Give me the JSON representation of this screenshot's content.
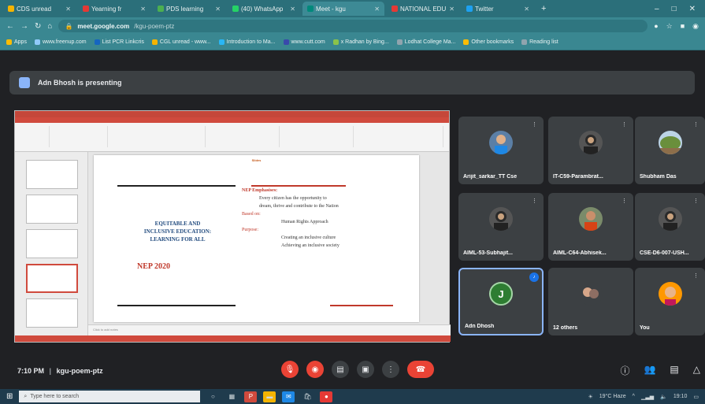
{
  "browser": {
    "tabs": [
      {
        "label": "CDS unread",
        "color": "#f4b400",
        "active": false
      },
      {
        "label": "Yearning fr",
        "color": "#e53935",
        "active": false
      },
      {
        "label": "PDS learning",
        "color": "#4caf50",
        "active": false
      },
      {
        "label": "(40) WhatsApp",
        "color": "#25d366",
        "active": false
      },
      {
        "label": "Meet - kgu",
        "color": "#00897b",
        "active": true
      },
      {
        "label": "NATIONAL EDU",
        "color": "#e53935",
        "active": false
      },
      {
        "label": "Twitter",
        "color": "#1da1f2",
        "active": false
      }
    ],
    "new_tab": "+",
    "window_controls": [
      "–",
      "□",
      "✕"
    ],
    "url": {
      "host": "meet.google.com",
      "path": "/kgu-poem-ptz"
    },
    "bookmarks": [
      {
        "label": "Apps",
        "color": "#fbbc04"
      },
      {
        "label": "www.freenup.com",
        "color": "#90caf9"
      },
      {
        "label": "List PCR Linkcris",
        "color": "#1565c0"
      },
      {
        "label": "CGL unread - www...",
        "color": "#f4b400"
      },
      {
        "label": "Introduction to Ma...",
        "color": "#29b6f6"
      },
      {
        "label": "www.cutt.com",
        "color": "#3949ab"
      },
      {
        "label": "x Radhan by Bing...",
        "color": "#8bc34a"
      },
      {
        "label": "Lodhat College Ma...",
        "color": "#90a4ae"
      },
      {
        "label": "Other bookmarks",
        "color": "#fbbc04"
      },
      {
        "label": "Reading list",
        "color": "#90a4ae"
      }
    ]
  },
  "meet": {
    "presenting_text": "Adn Bhosh is presenting",
    "slide": {
      "small_title": "Slides",
      "left_heading": [
        "EQUITABLE AND",
        "INCLUSIVE EDUCATION:",
        "LEARNING FOR ALL"
      ],
      "nep": "NEP 2020",
      "right": {
        "heading": "NEP Emphasises:",
        "line1": "Every citizen has the opportunity to",
        "line2": "dream, thrive and contribute to the Nation",
        "sub1": "Based on:",
        "b1": "Human Rights Approach",
        "sub2": "Purpose:",
        "b2a": "Creating an inclusive culture",
        "b2b": "Achieving an inclusive society"
      },
      "notes": "Click to add notes"
    },
    "participants": [
      {
        "name": "Arijit_sarkar_TT Cse",
        "avatar": "person-blue"
      },
      {
        "name": "IT-C59-Parambrat...",
        "avatar": "person-dark"
      },
      {
        "name": "Shubham Das",
        "avatar": "landscape"
      },
      {
        "name": "AIML-53-Subhajit...",
        "avatar": "person-dark"
      },
      {
        "name": "AIML-C64-Abhisek...",
        "avatar": "person-green"
      },
      {
        "name": "CSE-D6-007-USH...",
        "avatar": "person-dark"
      },
      {
        "name": "Adn Dhosh",
        "avatar": "letter",
        "letter": "J",
        "speaking": true
      },
      {
        "name": "12 others",
        "avatar": "group"
      },
      {
        "name": "You",
        "avatar": "person-orange"
      }
    ],
    "meeting_time": "7:10 PM",
    "meeting_code": "kgu-poem-ptz"
  },
  "taskbar": {
    "search_placeholder": "Type here to search",
    "weather": "19°C Haze",
    "time": "19:10"
  }
}
